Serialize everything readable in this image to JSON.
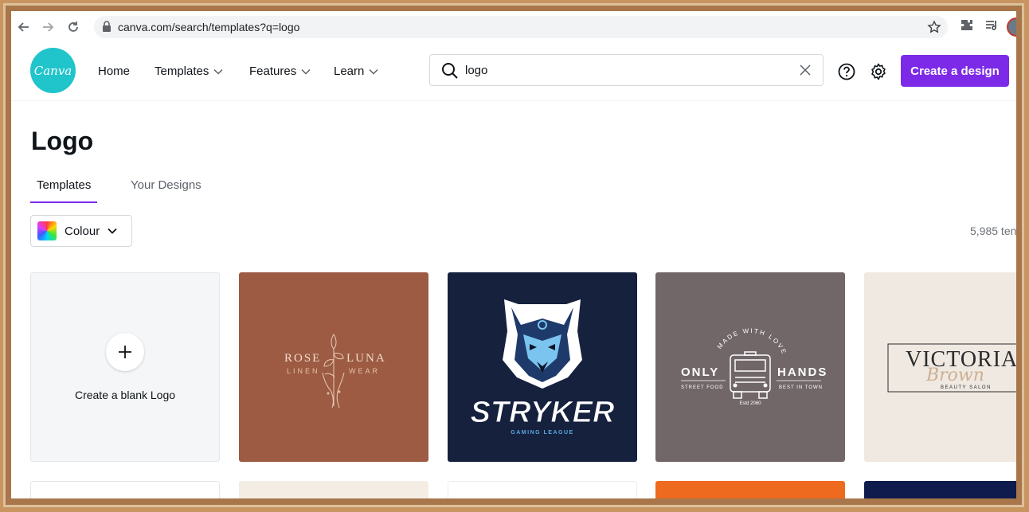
{
  "browser": {
    "url": "canva.com/search/templates?q=logo"
  },
  "header": {
    "logo_text": "Canva",
    "nav": [
      {
        "label": "Home",
        "has_dropdown": false
      },
      {
        "label": "Templates",
        "has_dropdown": true
      },
      {
        "label": "Features",
        "has_dropdown": true
      },
      {
        "label": "Learn",
        "has_dropdown": true
      }
    ],
    "search_value": "logo",
    "create_label": "Create a design",
    "accent_color": "#7d2ae8",
    "logo_color": "#20c4cb"
  },
  "page": {
    "title": "Logo",
    "tabs": [
      {
        "label": "Templates",
        "active": true
      },
      {
        "label": "Your Designs",
        "active": false
      }
    ],
    "filter_label": "Colour",
    "result_count": "5,985 ten"
  },
  "templates": {
    "blank_label": "Create a blank Logo",
    "cards": [
      {
        "bg": "#9c5b42",
        "line1a": "ROSE",
        "line1b": "LUNA",
        "line2a": "LINEN",
        "line2b": "WEAR"
      },
      {
        "bg": "#16213e",
        "name": "STRYKER",
        "tagline": "GAMING LEAGUE"
      },
      {
        "bg": "#716769",
        "arc": "MADE WITH LOVE",
        "left": "ONLY",
        "right": "HANDS",
        "sub_left": "STREET FOOD",
        "sub_right": "BEST IN TOWN",
        "est": "Estd 2060"
      },
      {
        "bg": "#efe9e2",
        "name": "VICTORIA",
        "script": "Brown",
        "sub": "BEAUTY SALON"
      }
    ],
    "row2_colors": [
      "#ffffff",
      "#f4ede4",
      "#ffffff",
      "#ee6a1e",
      "#0f1b4c"
    ]
  }
}
